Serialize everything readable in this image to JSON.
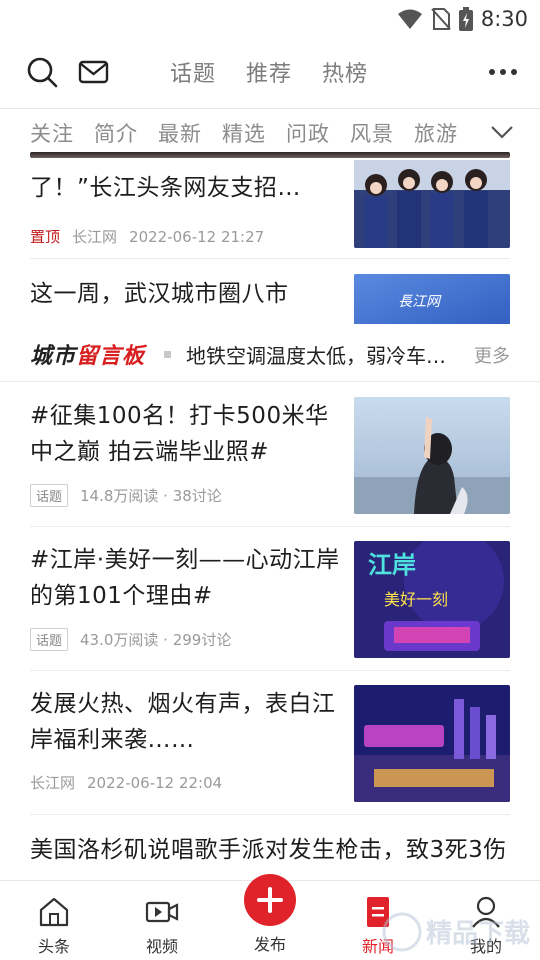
{
  "status_bar": {
    "time": "8:30"
  },
  "header": {
    "tabs": [
      "话题",
      "推荐",
      "热榜"
    ]
  },
  "channels": [
    "关注",
    "简介",
    "最新",
    "精选",
    "问政",
    "风景",
    "旅游"
  ],
  "feed": {
    "item1": {
      "title": "了！”长江头条网友支招…",
      "tag": "置顶",
      "source": "长江网",
      "time": "2022-06-12 21:27"
    },
    "item2": {
      "title": "这一周，武汉城市圈八市"
    },
    "board": {
      "logo_part1": "城市",
      "logo_part2": "留言板",
      "text": "地铁空调温度太低，弱冷车厢不...",
      "more": "更多"
    },
    "item3": {
      "title": "#征集100名！打卡500米华中之巅 拍云端毕业照#",
      "badge": "话题",
      "stats": "14.8万阅读 · 38讨论"
    },
    "item4": {
      "title": "#江岸·美好一刻——心动江岸的第101个理由#",
      "badge": "话题",
      "stats": "43.0万阅读 · 299讨论",
      "thumb_text1": "江岸",
      "thumb_text2": "美好一刻"
    },
    "item5": {
      "title": "发展火热、烟火有声，表白江岸福利来袭……",
      "source": "长江网",
      "time": "2022-06-12 22:04"
    },
    "item6": {
      "title": "美国洛杉矶说唱歌手派对发生枪击，致3死3伤"
    }
  },
  "bottom_nav": {
    "items": [
      {
        "label": "头条"
      },
      {
        "label": "视频"
      },
      {
        "label": "发布"
      },
      {
        "label": "新闻"
      },
      {
        "label": "我的"
      }
    ]
  },
  "colors": {
    "accent_red": "#e0232b",
    "text_gray": "#8c8c8c"
  },
  "watermark": "精品下载"
}
